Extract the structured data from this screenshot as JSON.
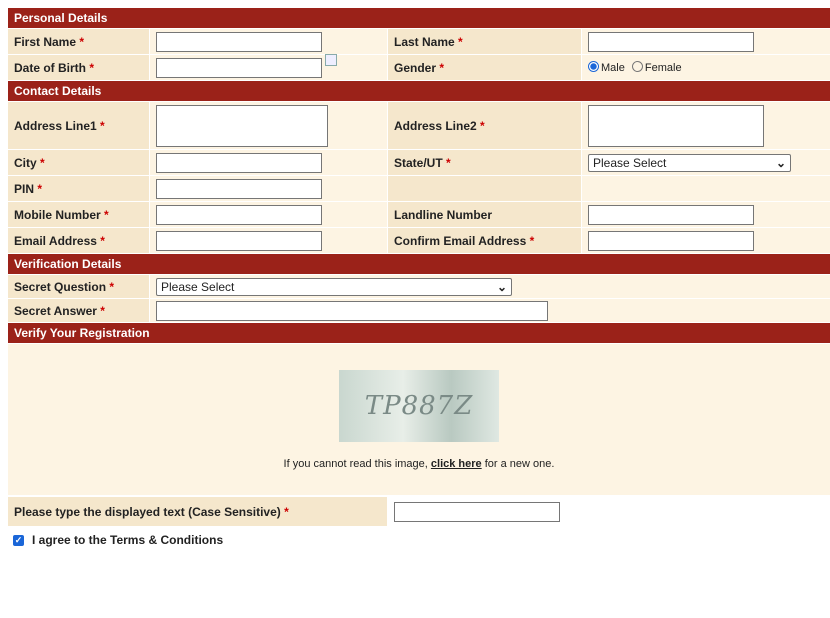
{
  "sections": {
    "personal": "Personal Details",
    "contact": "Contact Details",
    "verification": "Verification Details",
    "verify": "Verify Your Registration"
  },
  "labels": {
    "first_name": "First Name",
    "last_name": "Last Name",
    "dob": "Date of Birth",
    "gender": "Gender",
    "address1": "Address Line1",
    "address2": "Address Line2",
    "city": "City",
    "state": "State/UT",
    "pin": "PIN",
    "mobile": "Mobile Number",
    "landline": "Landline Number",
    "email": "Email Address",
    "confirm_email": "Confirm Email Address",
    "secret_question": "Secret Question",
    "secret_answer": "Secret Answer",
    "captcha_prompt": "Please type the displayed text (Case Sensitive)"
  },
  "required_marker": "*",
  "gender_options": {
    "male": "Male",
    "female": "Female",
    "selected": "Male"
  },
  "state_select": {
    "value": "Please Select"
  },
  "question_select": {
    "value": "Please Select"
  },
  "captcha": {
    "text": "TP887Z",
    "note_before": "If you cannot read this image, ",
    "link": "click here",
    "note_after": " for a new one."
  },
  "terms": {
    "label": "I agree to the Terms & Conditions",
    "checked": true
  },
  "colors": {
    "header": "#9b2219",
    "label_bg": "#f5e7cc",
    "row_bg": "#fdf4e3",
    "accent": "#1a66d8"
  }
}
